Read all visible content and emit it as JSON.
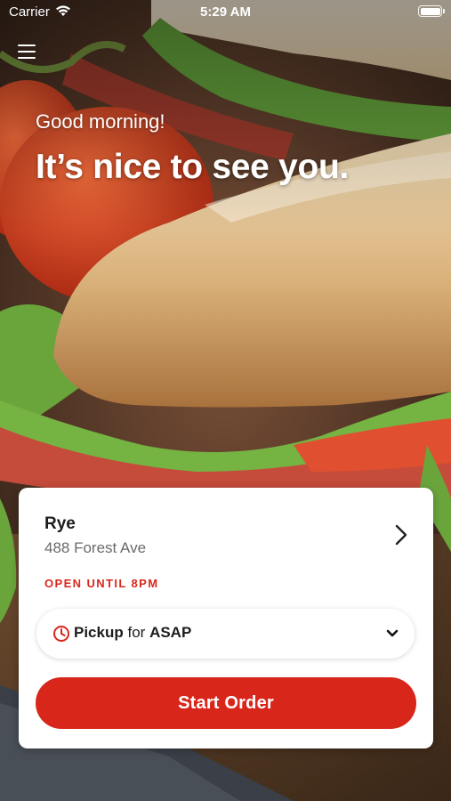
{
  "status_bar": {
    "carrier": "Carrier",
    "time": "5:29 AM",
    "wifi_icon": "wifi-icon",
    "battery_icon": "battery-icon"
  },
  "header": {
    "menu_icon": "hamburger-menu-icon"
  },
  "hero": {
    "greeting": "Good morning!",
    "headline": "It’s nice to see you."
  },
  "store_card": {
    "store_name": "Rye",
    "address": "488 Forest Ave",
    "hours": "OPEN UNTIL 8PM",
    "chevron_icon": "chevron-right-icon",
    "order_mode": {
      "clock_icon": "clock-icon",
      "mode": "Pickup",
      "connector": "for",
      "time": "ASAP",
      "chevron_icon": "chevron-down-icon"
    },
    "start_order_label": "Start Order"
  },
  "colors": {
    "brand_red": "#d8261b",
    "text_dark": "#1c1c1c",
    "text_muted": "#6a6a6a",
    "card_background": "#ffffff"
  }
}
